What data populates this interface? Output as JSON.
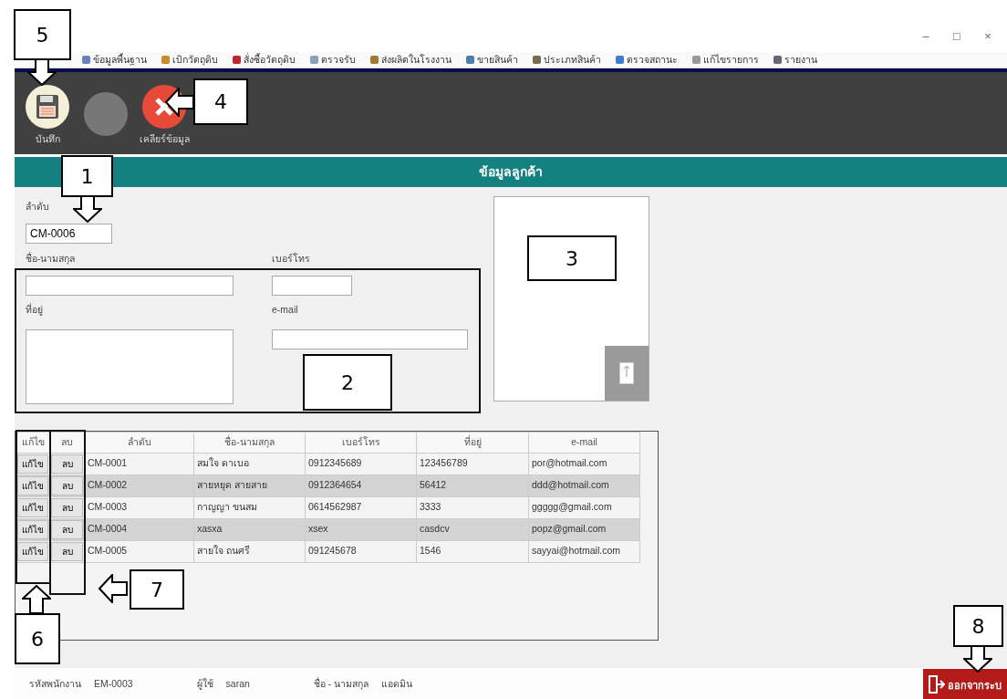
{
  "window": {
    "controls": [
      "–",
      "□",
      "×"
    ]
  },
  "menu": [
    {
      "label": "ข้อมูลพื้นฐาน"
    },
    {
      "label": "เบิกวัตถุดิบ"
    },
    {
      "label": "สั่งซื้อวัตถุดิบ"
    },
    {
      "label": "ตรวจรับ"
    },
    {
      "label": "ส่งผลิตในโรงงาน"
    },
    {
      "label": "ขายสินค้า"
    },
    {
      "label": "ประเภทสินค้า"
    },
    {
      "label": "ตรวจสถานะ"
    },
    {
      "label": "แก้ไขรายการ"
    },
    {
      "label": "รายงาน"
    }
  ],
  "toolbar": [
    {
      "kind": "save",
      "label": "บันทึก",
      "disabled": false
    },
    {
      "kind": "blank",
      "disabled": true
    },
    {
      "kind": "clear",
      "label": "เคลียร์ข้อมูล",
      "disabled": false
    }
  ],
  "header": "ข้อมูลลูกค้า",
  "form": {
    "id_label": "ลำดับ",
    "id_value": "CM-0006",
    "name_label": "ชื่อ-นามสกุล",
    "phone_label": "เบอร์โทร",
    "address_label": "ที่อยู่",
    "email_label": "e-mail"
  },
  "table": {
    "columns": [
      "แก้ไข",
      "ลบ",
      "ลำดับ",
      "ชื่อ-นามสกุล",
      "เบอร์โทร",
      "ที่อยู่",
      "e-mail"
    ],
    "rows": [
      {
        "cells": [
          "แก้ไข",
          "ลบ",
          "CM-0001",
          "สมใจ ดาเบอ",
          "0912345689",
          "123456789",
          "por@hotmail.com"
        ]
      },
      {
        "cells": [
          "แก้ไข",
          "ลบ",
          "CM-0002",
          "สายหยุด สายสาย",
          "0912364654",
          "56412",
          "ddd@hotmail.com"
        ]
      },
      {
        "cells": [
          "แก้ไข",
          "ลบ",
          "CM-0003",
          "กาญญา ขนสม",
          "0614562987",
          "3333",
          "ggggg@gmail.com"
        ]
      },
      {
        "cells": [
          "แก้ไข",
          "ลบ",
          "CM-0004",
          "xasxa",
          "xsex",
          "casdcv",
          "popz@gmail.com"
        ]
      },
      {
        "cells": [
          "แก้ไข",
          "ลบ",
          "CM-0005",
          "สายใจ ถนศรี",
          "091245678",
          "1546",
          "sayyai@hotmail.com"
        ]
      }
    ]
  },
  "status_bar": [
    {
      "label": "รหัสพนักงาน",
      "value": "EM-0003"
    },
    {
      "label": "ผู้ใช้",
      "value": "saran"
    },
    {
      "label": "ชื่อ - นามสกุล",
      "value": "แอดมิน"
    }
  ],
  "logout": "ออกจากระบ",
  "annotations": [
    {
      "label": "1",
      "kind": "down"
    },
    {
      "label": "2",
      "kind": "plain"
    },
    {
      "label": "3",
      "kind": "plain"
    },
    {
      "label": "4",
      "kind": "left"
    },
    {
      "label": "5",
      "kind": "down"
    },
    {
      "label": "6",
      "kind": "up"
    },
    {
      "label": "7",
      "kind": "left"
    },
    {
      "label": "8",
      "kind": "down"
    }
  ]
}
